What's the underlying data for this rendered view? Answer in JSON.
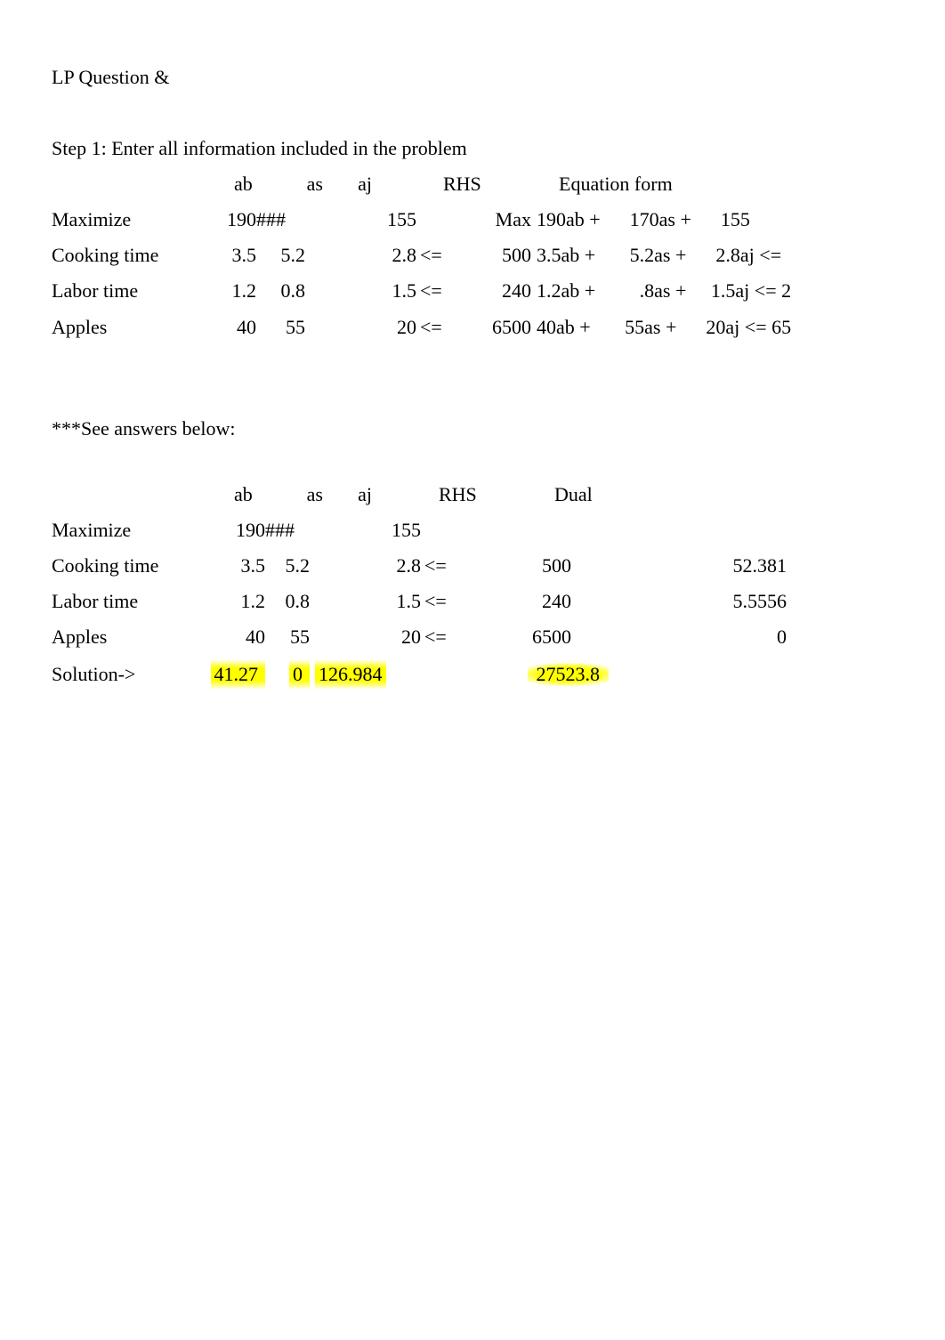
{
  "title": "LP Question &",
  "step1_heading": "Step 1: Enter all information included in the problem",
  "see_answers": "***See answers below:",
  "hdr1": {
    "ab": "ab",
    "as": "as",
    "aj": "aj",
    "rhs": "RHS",
    "eq": "Equation form"
  },
  "t1": {
    "maximize": {
      "label": "Maximize",
      "ab": "190",
      "as": "###",
      "aj": "",
      "val": "155",
      "op": "",
      "rhs": "Max",
      "eq": "190ab +      170as +      155"
    },
    "cooking": {
      "label": "Cooking time",
      "ab": "3.5",
      "as": "5.2",
      "aj": "",
      "val": "2.8",
      "op": "<=",
      "rhs": "500",
      "eq": "3.5ab +       5.2as +      2.8aj <="
    },
    "labor": {
      "label": "Labor time",
      "ab": "1.2",
      "as": "0.8",
      "aj": "",
      "val": "1.5",
      "op": "<=",
      "rhs": "240",
      "eq": "1.2ab +         .8as +     1.5aj <= 2"
    },
    "apples": {
      "label": "Apples",
      "ab": "40",
      "as": "55",
      "aj": "",
      "val": "20",
      "op": "<=",
      "rhs": "6500",
      "eq": "40ab +       55as +      20aj <= 65"
    }
  },
  "hdr2": {
    "ab": "ab",
    "as": "as",
    "aj": "aj",
    "rhs": "RHS",
    "dual": "Dual"
  },
  "t2": {
    "maximize": {
      "label": "Maximize",
      "ab": "190",
      "as": "###",
      "aj": "",
      "val": "155",
      "op": "",
      "rhs": "",
      "dual": ""
    },
    "cooking": {
      "label": "Cooking time",
      "ab": "3.5",
      "as": "5.2",
      "aj": "",
      "val": "2.8",
      "op": "<=",
      "rhs": "500",
      "dual": "52.381"
    },
    "labor": {
      "label": "Labor time",
      "ab": "1.2",
      "as": "0.8",
      "aj": "",
      "val": "1.5",
      "op": "<=",
      "rhs": "240",
      "dual": "5.5556"
    },
    "apples": {
      "label": "Apples",
      "ab": "40",
      "as": "55",
      "aj": "",
      "val": "20",
      "op": "<=",
      "rhs": "6500",
      "dual": "0"
    },
    "solution": {
      "label": "Solution->",
      "ab": "41.27",
      "as": "0",
      "aj": "126.984",
      "val": "",
      "op": "",
      "rhs": "27523.8",
      "dual": ""
    }
  },
  "chart_data": {
    "type": "table",
    "title": "LP problem coefficients and solution",
    "problem": {
      "objective": {
        "ab": 190,
        "as": null,
        "aj": 155,
        "type": "Maximize"
      },
      "constraints": [
        {
          "name": "Cooking time",
          "ab": 3.5,
          "as": 5.2,
          "aj": 2.8,
          "op": "<=",
          "rhs": 500
        },
        {
          "name": "Labor time",
          "ab": 1.2,
          "as": 0.8,
          "aj": 1.5,
          "op": "<=",
          "rhs": 240
        },
        {
          "name": "Apples",
          "ab": 40,
          "as": 55,
          "aj": 20,
          "op": "<=",
          "rhs": 6500
        }
      ]
    },
    "solution": {
      "ab": 41.27,
      "as": 0,
      "aj": 126.984,
      "objective_value": 27523.8,
      "duals": {
        "Cooking time": 52.381,
        "Labor time": 5.5556,
        "Apples": 0
      }
    }
  }
}
